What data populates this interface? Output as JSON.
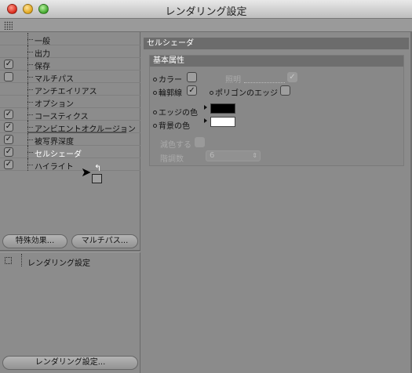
{
  "window": {
    "title": "レンダリング設定"
  },
  "tree": {
    "items": [
      {
        "label": "一般",
        "checked": null,
        "selected": false
      },
      {
        "label": "出力",
        "checked": null,
        "selected": false
      },
      {
        "label": "保存",
        "checked": true,
        "selected": false
      },
      {
        "label": "マルチパス",
        "checked": false,
        "selected": false
      },
      {
        "label": "アンチエイリアス",
        "checked": null,
        "selected": false
      },
      {
        "label": "オプション",
        "checked": null,
        "selected": false
      },
      {
        "label": "コースティクス",
        "checked": true,
        "selected": false
      },
      {
        "label": "アンビエントオクルージョン",
        "checked": true,
        "selected": false
      },
      {
        "label": "被写界深度",
        "checked": true,
        "selected": false
      },
      {
        "label": "セルシェーダ",
        "checked": true,
        "selected": true
      },
      {
        "label": "ハイライト",
        "checked": true,
        "selected": false
      }
    ],
    "check_mark": "✓"
  },
  "buttons": {
    "effects": "特殊効果...",
    "multipass": "マルチパス...",
    "render_settings": "レンダリング設定..."
  },
  "render_settings_item": {
    "label": "レンダリング設定"
  },
  "panel": {
    "title": "セルシェーダ",
    "group_title": "基本属性",
    "color_label": "カラー",
    "lighting_label": "照明",
    "outline_label": "輪郭線",
    "polygon_edge_label": "ポリゴンのエッジ",
    "edge_color_label": "エッジの色",
    "bg_color_label": "背景の色",
    "reduce_color_label": "減色する",
    "levels_label": "階調数",
    "levels_value": "6",
    "edge_color": "#000000",
    "bg_color": "#ffffff",
    "values": {
      "color": false,
      "lighting": true,
      "outline": true,
      "polygon_edge": false,
      "reduce_color": false
    }
  }
}
